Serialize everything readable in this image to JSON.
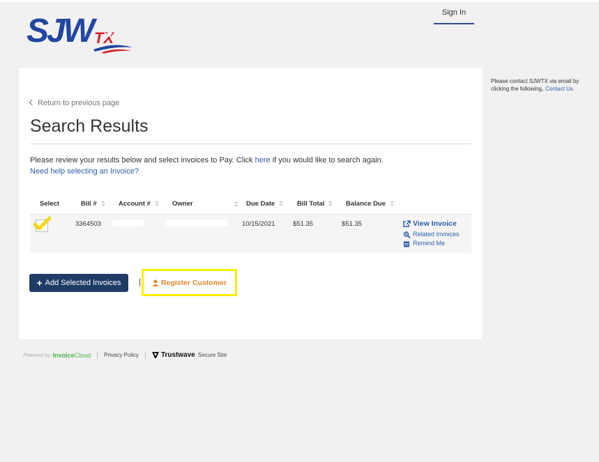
{
  "header": {
    "logo_text": "SJWTX",
    "sign_in": "Sign In"
  },
  "main": {
    "back_link": "Return to previous page",
    "title": "Search Results",
    "instructions_before": "Please review your results below and select invoices to Pay. Click",
    "instructions_link": "here",
    "instructions_after": "if you would like to search again.",
    "help_link": "Need help selecting an Invoice?"
  },
  "table": {
    "headers": [
      "Select",
      "Bill #",
      "Account #",
      "Owner",
      "Due Date",
      "Bill Total",
      "Balance Due"
    ],
    "rows": [
      {
        "selected": true,
        "bill_no": "3364503",
        "due_date": "10/15/2021",
        "bill_total": "$51.35",
        "balance_due": "$51.35",
        "actions": {
          "view": "View Invoice",
          "related": "Related Invoices",
          "remind": "Remind Me"
        }
      }
    ]
  },
  "buttons": {
    "add_selected": "Add Selected Invoices",
    "separator": "|",
    "register": "Register Customer"
  },
  "sidebar": {
    "contact_text": "Please contact SJWTX via email by clicking the following,",
    "contact_link": "Contact Us"
  },
  "footer": {
    "powered_by": "Powered by",
    "brand_part1": "Invoice",
    "brand_part2": "Cloud",
    "privacy": "Privacy Policy",
    "trustwave": "Trustwave",
    "secure": "Secure Site"
  },
  "colors": {
    "accent_blue": "#2a5ea8",
    "button_navy": "#1f3c67",
    "register_orange": "#e3872d",
    "highlight_yellow": "#ffee00",
    "check_yellow": "#f3d613",
    "invoicecloud_green": "#4cae4c"
  },
  "icons": [
    "chevron-left-icon",
    "checkmark-icon",
    "external-link-icon",
    "zoom-icon",
    "calendar-icon",
    "plus-icon",
    "user-icon",
    "trustwave-logo-icon"
  ]
}
